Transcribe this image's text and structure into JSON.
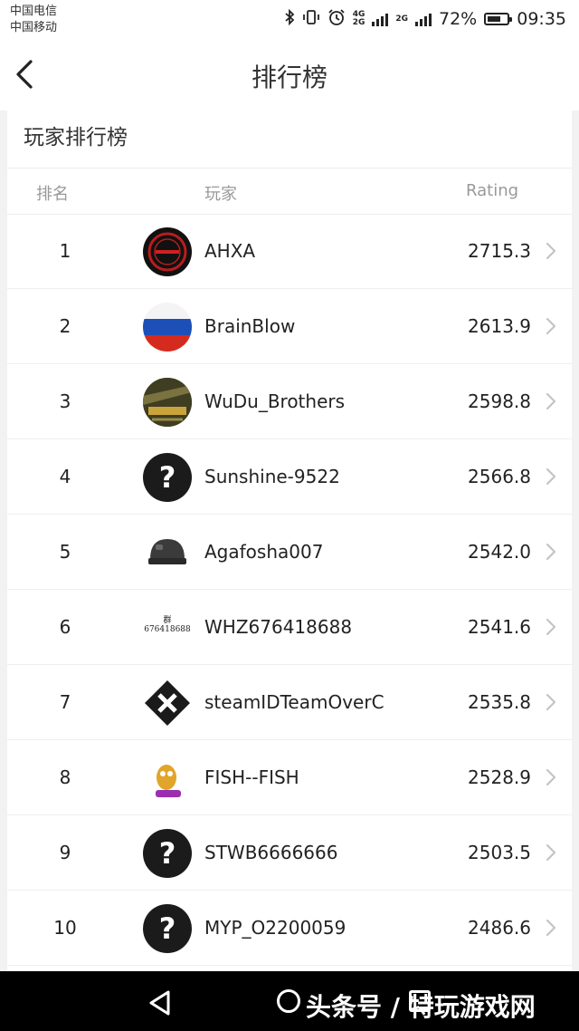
{
  "status_bar": {
    "carrier_1": "中国电信",
    "carrier_2": "中国移动",
    "net_1_top": "4G",
    "net_1_bottom": "2G",
    "net_2": "2G",
    "battery": "72%",
    "battery_level": 0.72,
    "time": "09:35"
  },
  "header": {
    "title": "排行榜"
  },
  "card": {
    "title": "玩家排行榜",
    "columns": {
      "rank": "排名",
      "player": "玩家",
      "rating": "Rating"
    }
  },
  "rows": [
    {
      "rank": "1",
      "name": "AHXA",
      "rating": "2715.3",
      "avatar": "red-logo-avatar"
    },
    {
      "rank": "2",
      "name": "BrainBlow",
      "rating": "2613.9",
      "avatar": "russian-flag-avatar"
    },
    {
      "rank": "3",
      "name": "WuDu_Brothers",
      "rating": "2598.8",
      "avatar": "battlegrounds-avatar"
    },
    {
      "rank": "4",
      "name": "Sunshine-9522",
      "rating": "2566.8",
      "avatar": "question-mark-avatar"
    },
    {
      "rank": "5",
      "name": "Agafosha007",
      "rating": "2542.0",
      "avatar": "helmet-avatar"
    },
    {
      "rank": "6",
      "name": "WHZ676418688",
      "rating": "2541.6",
      "avatar": "text-avatar",
      "avatar_text_1": "群",
      "avatar_text_2": "676418688"
    },
    {
      "rank": "7",
      "name": "steamIDTeamOverC",
      "rating": "2535.8",
      "avatar": "team-logo-avatar"
    },
    {
      "rank": "8",
      "name": "FISH--FISH",
      "rating": "2528.9",
      "avatar": "cartoon-avatar"
    },
    {
      "rank": "9",
      "name": "STWB6666666",
      "rating": "2503.5",
      "avatar": "question-mark-avatar"
    },
    {
      "rank": "10",
      "name": "MYP_O2200059",
      "rating": "2486.6",
      "avatar": "question-mark-avatar"
    }
  ],
  "watermark": "头条号 / 特玩游戏网",
  "colors": {
    "background": "#f2f2f2",
    "card": "#ffffff",
    "text": "#222222",
    "muted": "#999999",
    "system_bar": "#000000"
  }
}
